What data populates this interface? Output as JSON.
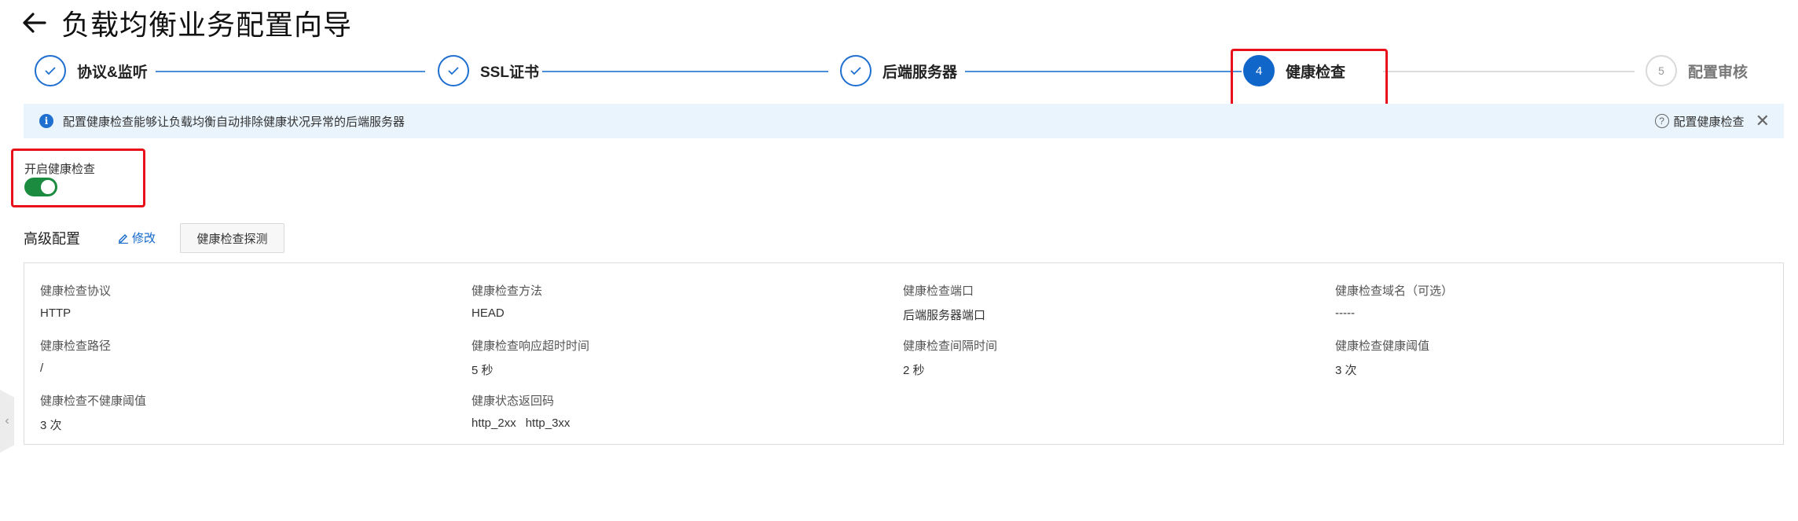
{
  "header": {
    "title": "负载均衡业务配置向导"
  },
  "steps": [
    {
      "number": "1",
      "label": "协议&监听",
      "state": "done"
    },
    {
      "number": "2",
      "label": "SSL证书",
      "state": "done"
    },
    {
      "number": "3",
      "label": "后端服务器",
      "state": "done"
    },
    {
      "number": "4",
      "label": "健康检查",
      "state": "active"
    },
    {
      "number": "5",
      "label": "配置审核",
      "state": "pending"
    }
  ],
  "banner": {
    "text": "配置健康检查能够让负载均衡自动排除健康状况异常的后端服务器",
    "help_label": "配置健康检查"
  },
  "toggle": {
    "label": "开启健康检查",
    "enabled": true
  },
  "advanced": {
    "title": "高级配置",
    "edit_label": "修改",
    "probe_button_label": "健康检查探测"
  },
  "fields": [
    {
      "label": "健康检查协议",
      "value": "HTTP"
    },
    {
      "label": "健康检查方法",
      "value": "HEAD"
    },
    {
      "label": "健康检查端口",
      "value": "后端服务器端口"
    },
    {
      "label": "健康检查域名（可选）",
      "value": "-----"
    },
    {
      "label": "健康检查路径",
      "value": "/"
    },
    {
      "label": "健康检查响应超时时间",
      "value": "5 秒"
    },
    {
      "label": "健康检查间隔时间",
      "value": "2 秒"
    },
    {
      "label": "健康检查健康阈值",
      "value": "3 次"
    },
    {
      "label": "健康检查不健康阈值",
      "value": "3 次"
    },
    {
      "label": "健康状态返回码",
      "value_parts": [
        "http_2xx",
        "http_3xx"
      ]
    }
  ],
  "colors": {
    "accent": "#1166c9",
    "highlight": "#e8101a",
    "toggle_on": "#1b8c3f",
    "banner_bg": "#e9f4fd"
  }
}
